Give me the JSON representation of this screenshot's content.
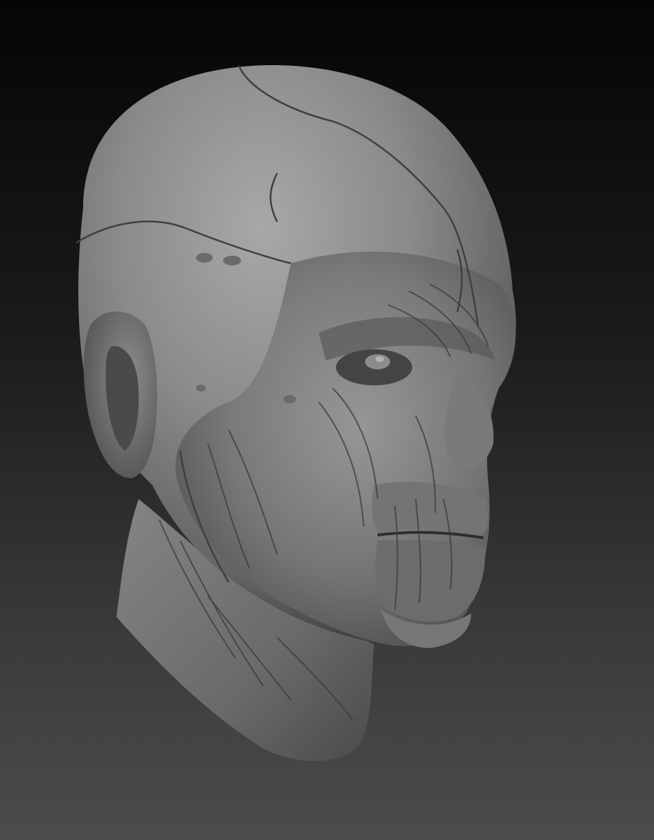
{
  "scene": {
    "subject": "sculpted-head",
    "material": "matcap-gray",
    "colors": {
      "background_top": "#050505",
      "background_bottom": "#4c4c4c",
      "skin_light": "#a6a6a6",
      "skin_mid": "#7c7c7c",
      "skin_dark": "#3c3c3c",
      "crease": "#2e2e2e"
    }
  }
}
